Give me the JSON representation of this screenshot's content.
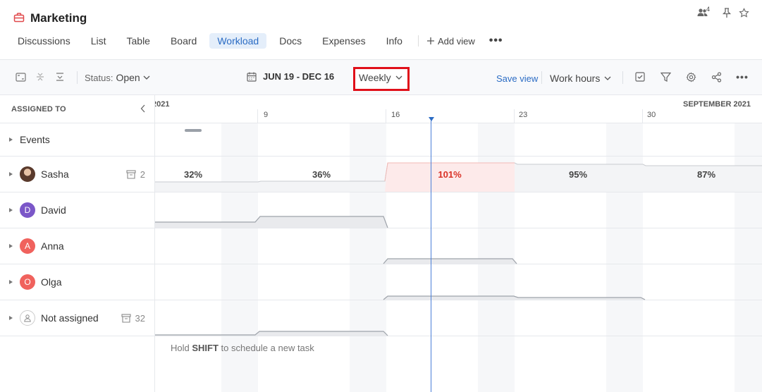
{
  "project": {
    "title": "Marketing",
    "members_count": "4"
  },
  "tabs": [
    {
      "label": "Discussions"
    },
    {
      "label": "List"
    },
    {
      "label": "Table"
    },
    {
      "label": "Board"
    },
    {
      "label": "Workload",
      "active": true
    },
    {
      "label": "Docs"
    },
    {
      "label": "Expenses"
    },
    {
      "label": "Info"
    }
  ],
  "add_view_label": "Add view",
  "toolbar": {
    "status_label": "Status:",
    "status_value": "Open",
    "date_range": "JUN 19 - DEC 16",
    "scale": "Weekly",
    "save_view": "Save view",
    "metric": "Work hours"
  },
  "left_panel": {
    "header": "ASSIGNED TO",
    "rows": [
      {
        "name": "Events",
        "avatar": ""
      },
      {
        "name": "Sasha",
        "avatar": "photo",
        "archived_count": "2"
      },
      {
        "name": "David",
        "avatar": "D",
        "color": "#7b57c8"
      },
      {
        "name": "Anna",
        "avatar": "A",
        "color": "#f0625d"
      },
      {
        "name": "Olga",
        "avatar": "O",
        "color": "#f0625d"
      },
      {
        "name": "Not assigned",
        "avatar": "user-icon",
        "archived_count": "32"
      }
    ]
  },
  "timeline": {
    "month_left": "2021",
    "month_right": "SEPTEMBER 2021",
    "weeks": [
      "9",
      "16",
      "23",
      "30"
    ],
    "sasha_workload": [
      "32%",
      "36%",
      "101%",
      "95%",
      "87%"
    ],
    "overloaded_index": 2,
    "hint_pre": "Hold ",
    "hint_key": "SHIFT",
    "hint_post": " to schedule a new task"
  },
  "colors": {
    "accent": "#2b6cc4",
    "overload": "#d93025",
    "highlight_box": "#e0101a"
  }
}
